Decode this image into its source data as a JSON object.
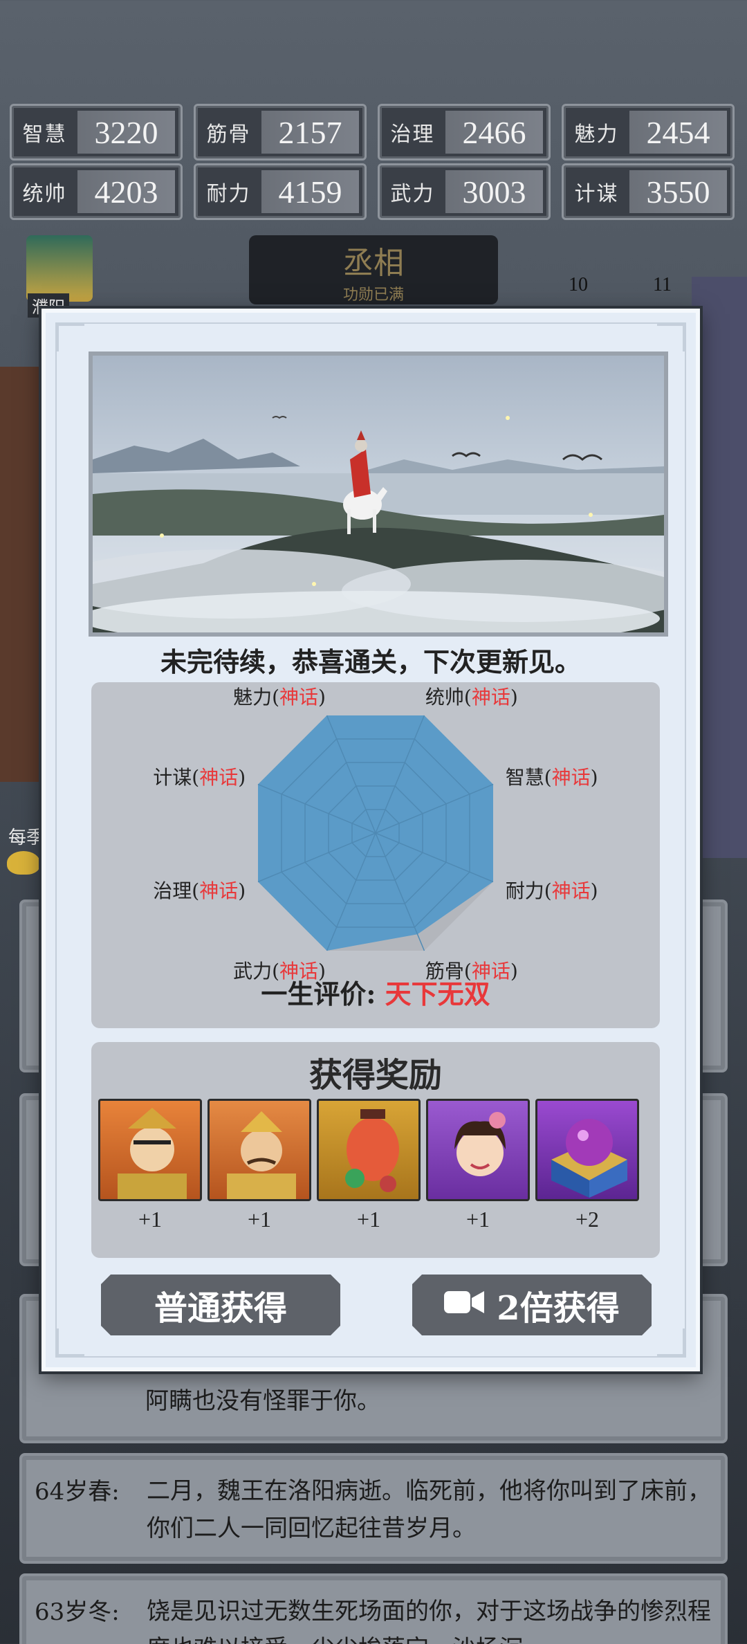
{
  "stats": [
    {
      "label": "智慧",
      "value": "3220"
    },
    {
      "label": "筋骨",
      "value": "2157"
    },
    {
      "label": "治理",
      "value": "2466"
    },
    {
      "label": "魅力",
      "value": "2454"
    },
    {
      "label": "统帅",
      "value": "4203"
    },
    {
      "label": "耐力",
      "value": "4159"
    },
    {
      "label": "武力",
      "value": "3003"
    },
    {
      "label": "计谋",
      "value": "3550"
    }
  ],
  "rank": {
    "title": "丞相",
    "subtitle": "功勋已满"
  },
  "left_labels": {
    "city": "濮阳",
    "season": "每季"
  },
  "level_badges": [
    "10",
    "11"
  ],
  "modal": {
    "caption": "未完待续，恭喜通关，下次更新见。",
    "radar": {
      "attributes": [
        {
          "name": "魅力",
          "grade": "神话",
          "value": 1.0
        },
        {
          "name": "统帅",
          "grade": "神话",
          "value": 1.0
        },
        {
          "name": "智慧",
          "grade": "神话",
          "value": 1.0
        },
        {
          "name": "耐力",
          "grade": "神话",
          "value": 1.0
        },
        {
          "name": "筋骨",
          "grade": "神话",
          "value": 0.86
        },
        {
          "name": "武力",
          "grade": "神话",
          "value": 1.0
        },
        {
          "name": "治理",
          "grade": "神话",
          "value": 1.0
        },
        {
          "name": "计谋",
          "grade": "神话",
          "value": 1.0
        }
      ],
      "fill_color": "#5b9bc8"
    },
    "verdict_label": "一生评价:",
    "verdict_value": "天下无双",
    "rewards_title": "获得奖励",
    "rewards": [
      {
        "icon": "general-portrait-1-icon",
        "count": "+1"
      },
      {
        "icon": "general-portrait-2-icon",
        "count": "+1"
      },
      {
        "icon": "lantern-bell-icon",
        "count": "+1"
      },
      {
        "icon": "lady-portrait-icon",
        "count": "+1"
      },
      {
        "icon": "treasure-chest-icon",
        "count": "+2"
      }
    ],
    "normal_button": "普通获得",
    "double_button": "2倍获得"
  },
  "log": [
    {
      "age": "",
      "text": "阿瞒也没有怪罪于你。"
    },
    {
      "age": "64岁春:",
      "text": "二月，魏王在洛阳病逝。临死前，他将你叫到了床前，你们二人一同回忆起往昔岁月。"
    },
    {
      "age": "63岁冬:",
      "text": "饶是见识过无数生死场面的你，对于这场战争的惨烈程度也难以接受。尘尘埃落定，沙场沉"
    }
  ],
  "colors": {
    "myth": "#e8383a",
    "panel": "#bfc3ca",
    "modal": "#e4ecf6",
    "button": "#5e6269"
  }
}
